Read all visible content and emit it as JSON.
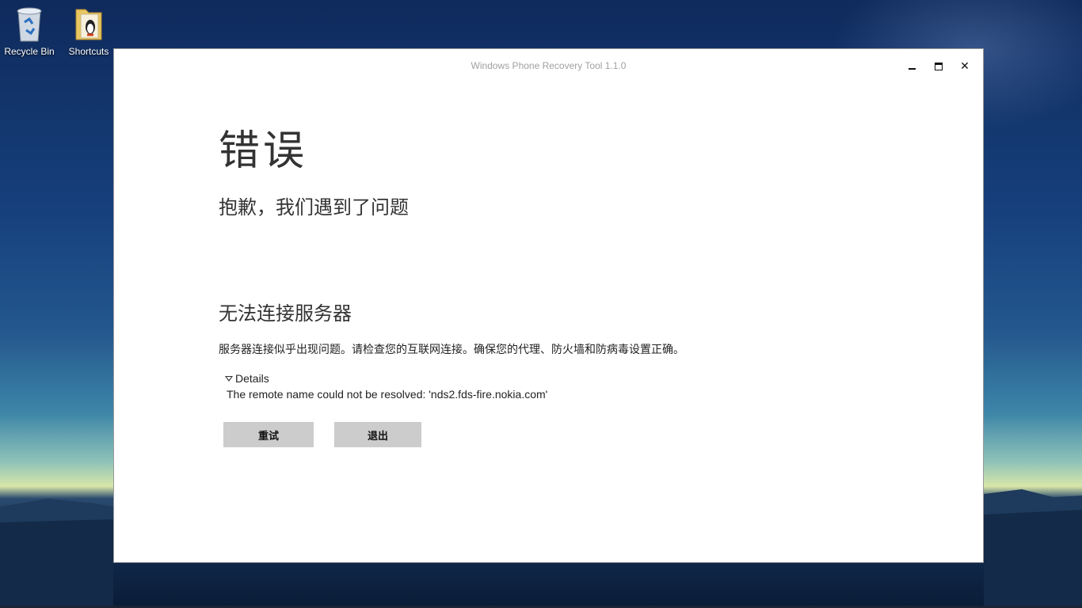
{
  "desktop": {
    "icons": [
      {
        "label": "Recycle Bin",
        "icon": "recycle-bin-icon"
      },
      {
        "label": "Shortcuts",
        "icon": "folder-icon"
      }
    ]
  },
  "window": {
    "title": "Windows Phone Recovery Tool 1.1.0",
    "controls": {
      "minimize": "minimize-icon",
      "maximize": "maximize-icon",
      "close_glyph": "✕"
    }
  },
  "page": {
    "title": "错误",
    "subtitle": "抱歉，我们遇到了问题",
    "error_heading": "无法连接服务器",
    "error_description": "服务器连接似乎出现问题。请检查您的互联网连接。确保您的代理、防火墙和防病毒设置正确。",
    "details_label": "Details",
    "details_text": "The remote name could not be resolved: 'nds2.fds-fire.nokia.com'",
    "buttons": {
      "retry": "重试",
      "exit": "退出"
    }
  },
  "colors": {
    "button_bg": "#cccccc",
    "window_bg": "#ffffff",
    "title_text": "#a0a0a0"
  }
}
